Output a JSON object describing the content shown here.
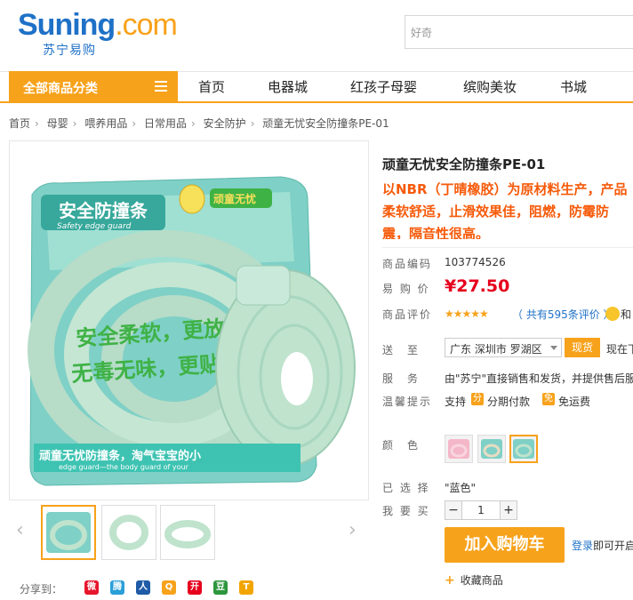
{
  "header": {
    "logo_main": "Suning",
    "logo_dotcom": ".com",
    "logo_sub": "苏宁易购",
    "search_placeholder": "好奇"
  },
  "nav": {
    "category_label": "全部商品分类",
    "items": [
      "首页",
      "电器城",
      "红孩子母婴",
      "缤购美妆",
      "书城"
    ]
  },
  "breadcrumb": [
    "首页",
    "母婴",
    "喂养用品",
    "日常用品",
    "安全防护",
    "顽童无忧安全防撞条PE-01"
  ],
  "product": {
    "title": "顽童无忧安全防撞条PE-01",
    "promo": "以NBR（丁晴橡胶）为原材料生产，产品柔软舒适，止滑效果佳，阻燃，防霉防震，隔音性很高。",
    "code_label": "商品编码",
    "code": "103774526",
    "price_label": "易 购 价",
    "price": "¥27.50",
    "review_label": "商品评价",
    "stars": "★★★★★",
    "review_text": "（ 共有595条评价 ）",
    "review_more": "和",
    "ship_label": "送　至",
    "region": "广东 深圳市 罗湖区",
    "stock": "现货",
    "ship_now": "现在下",
    "service_label": "服　务",
    "service_text": "由\"苏宁\"直接销售和发货，并提供售后服",
    "tips_label": "温馨提示",
    "tips_support": "支持",
    "tips_installment": "分期付款",
    "tips_free": "免运费",
    "tips_installment_icon": "分",
    "tips_free_icon": "免",
    "color_label": "颜　色",
    "selected_label": "已 选 择",
    "selected_value": "\"蓝色\"",
    "qty_label": "我 要 买",
    "qty_minus": "−",
    "qty_value": "1",
    "qty_plus": "+",
    "cart_button": "加入购物车",
    "login_link": "登录",
    "login_suffix": "即可开启",
    "favorite": "收藏商品",
    "favorite_plus": "+"
  },
  "share": {
    "label": "分享到：",
    "icons": [
      {
        "name": "weibo-icon",
        "glyph": "微",
        "color": "#e6162d"
      },
      {
        "name": "tencent-weibo-icon",
        "glyph": "腾",
        "color": "#2a9fd8"
      },
      {
        "name": "renren-icon",
        "glyph": "人",
        "color": "#1f5ba6"
      },
      {
        "name": "qzone-icon",
        "glyph": "Q",
        "color": "#f7a21b"
      },
      {
        "name": "kaixin-icon",
        "glyph": "开",
        "color": "#e6001c"
      },
      {
        "name": "douban-icon",
        "glyph": "豆",
        "color": "#2e963d"
      },
      {
        "name": "tianya-icon",
        "glyph": "T",
        "color": "#f2a500"
      }
    ]
  },
  "gallery": {
    "arrow_left": "‹",
    "arrow_right": "›",
    "packaging_text": "安全防撞条",
    "packaging_subtext": "Safety edge guard",
    "slogan_1": "安全柔软，更放心",
    "slogan_2": "无毒无味，更贴心",
    "brand": "顽童无忧",
    "bottom_text": "顽童无忧防撞条，淘气宝宝的小",
    "bottom_subtext": "edge guard—the body guard of your"
  },
  "colors": {
    "accent": "#f7a21b",
    "link": "#1f71c7",
    "price": "#e6001c",
    "promo": "#f65a0a",
    "mint": "#bfe3cd"
  }
}
